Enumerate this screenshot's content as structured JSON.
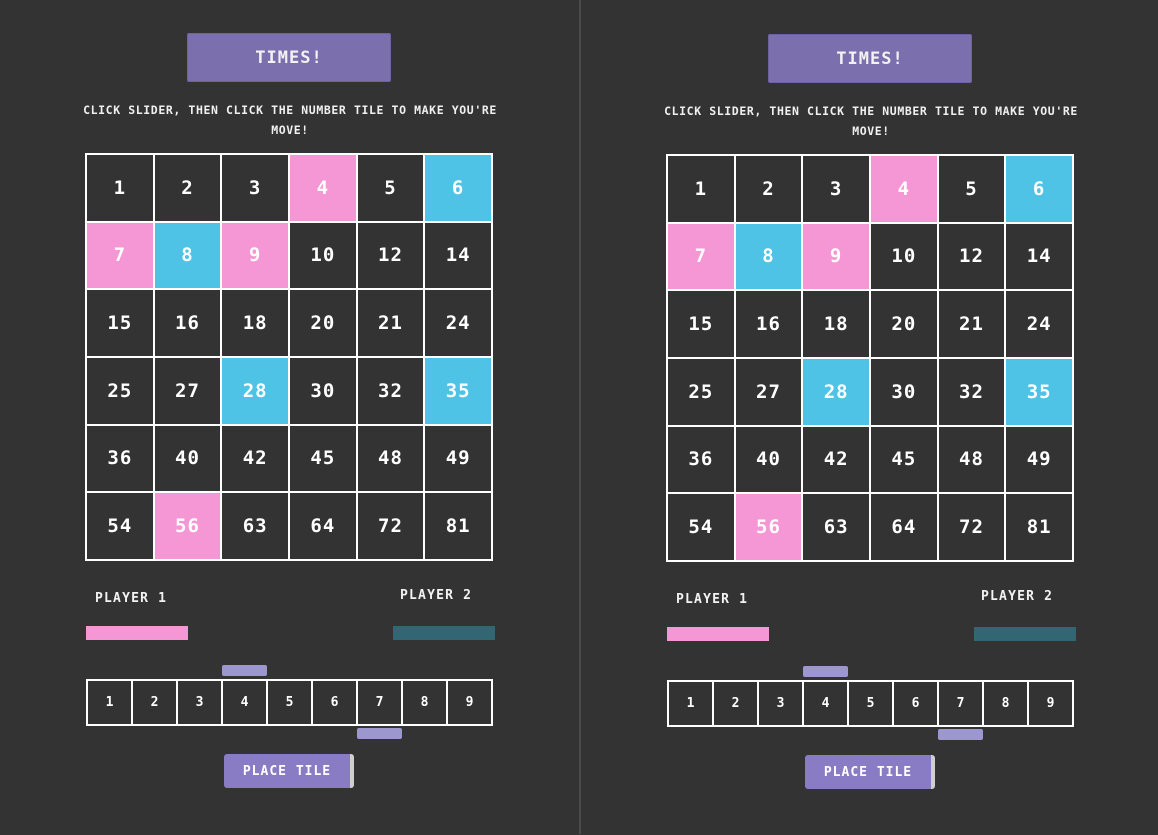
{
  "colors": {
    "background": "#333333",
    "accent_purple": "#7c6fae",
    "player1_pink": "#f597d4",
    "player2_blue": "#4ec3e6",
    "player2_bar": "#336673",
    "slider": "#9c97cf"
  },
  "game": {
    "title": "TIMES!",
    "instructions": "CLICK SLIDER, THEN CLICK THE NUMBER TILE TO MAKE YOU'RE MOVE!",
    "board": [
      {
        "value": "1",
        "owner": "none"
      },
      {
        "value": "2",
        "owner": "none"
      },
      {
        "value": "3",
        "owner": "none"
      },
      {
        "value": "4",
        "owner": "p1"
      },
      {
        "value": "5",
        "owner": "none"
      },
      {
        "value": "6",
        "owner": "p2"
      },
      {
        "value": "7",
        "owner": "p1"
      },
      {
        "value": "8",
        "owner": "p2"
      },
      {
        "value": "9",
        "owner": "p1"
      },
      {
        "value": "10",
        "owner": "none"
      },
      {
        "value": "12",
        "owner": "none"
      },
      {
        "value": "14",
        "owner": "none"
      },
      {
        "value": "15",
        "owner": "none"
      },
      {
        "value": "16",
        "owner": "none"
      },
      {
        "value": "18",
        "owner": "none"
      },
      {
        "value": "20",
        "owner": "none"
      },
      {
        "value": "21",
        "owner": "none"
      },
      {
        "value": "24",
        "owner": "none"
      },
      {
        "value": "25",
        "owner": "none"
      },
      {
        "value": "27",
        "owner": "none"
      },
      {
        "value": "28",
        "owner": "p2"
      },
      {
        "value": "30",
        "owner": "none"
      },
      {
        "value": "32",
        "owner": "none"
      },
      {
        "value": "35",
        "owner": "p2"
      },
      {
        "value": "36",
        "owner": "none"
      },
      {
        "value": "40",
        "owner": "none"
      },
      {
        "value": "42",
        "owner": "none"
      },
      {
        "value": "45",
        "owner": "none"
      },
      {
        "value": "48",
        "owner": "none"
      },
      {
        "value": "49",
        "owner": "none"
      },
      {
        "value": "54",
        "owner": "none"
      },
      {
        "value": "56",
        "owner": "p1"
      },
      {
        "value": "63",
        "owner": "none"
      },
      {
        "value": "64",
        "owner": "none"
      },
      {
        "value": "72",
        "owner": "none"
      },
      {
        "value": "81",
        "owner": "none"
      }
    ],
    "player1_label": "PLAYER 1",
    "player2_label": "PLAYER 2",
    "factors": [
      "1",
      "2",
      "3",
      "4",
      "5",
      "6",
      "7",
      "8",
      "9"
    ],
    "slider_top_position": "4",
    "slider_bottom_position": "7",
    "place_button_label": "PLACE TILE"
  }
}
